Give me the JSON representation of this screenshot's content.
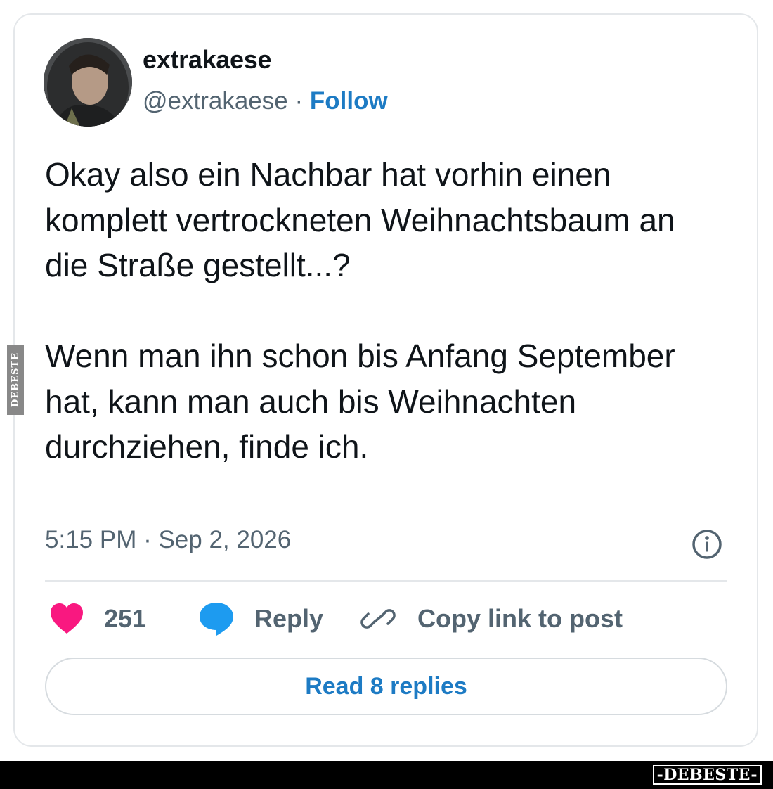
{
  "user": {
    "display_name": "extrakaese",
    "handle": "@extrakaese",
    "separator": "·",
    "follow_label": "Follow"
  },
  "tweet": {
    "paragraphs": [
      "Okay also ein Nachbar hat vorhin einen komplett vertrockneten Weihnachtsbaum an die Straße gestellt...?",
      "Wenn man ihn schon bis Anfang September hat, kann man auch bis Weihnachten durchziehen, finde ich."
    ],
    "timestamp": "5:15 PM · Sep 2, 2026"
  },
  "actions": {
    "likes_count": "251",
    "reply_label": "Reply",
    "copy_link_label": "Copy link to post",
    "read_replies_label": "Read 8 replies"
  },
  "icons": {
    "like": "heart-icon",
    "reply": "speech-bubble-icon",
    "copy_link": "link-icon",
    "info": "info-icon"
  },
  "colors": {
    "like": "#f91880",
    "reply": "#1d9bf0",
    "link_text": "#1d7bc4",
    "muted_text": "#536471"
  },
  "watermark": {
    "side_text": "DEBESTE",
    "bottom_text": "-DEBESTE-"
  }
}
